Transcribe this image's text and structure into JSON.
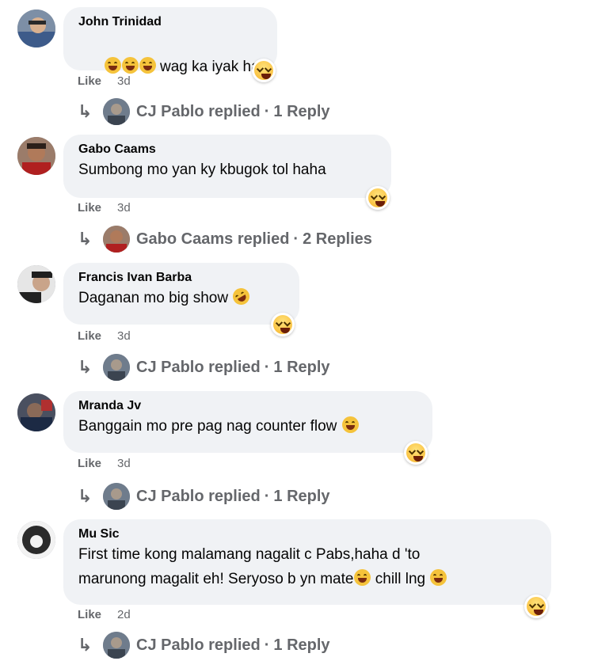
{
  "comments": [
    {
      "author": "John Trinidad",
      "text": "wag ka iyak ha",
      "leading_emojis": [
        "laughing-face",
        "laughing-face",
        "laughing-face"
      ],
      "like_label": "Like",
      "time": "3d",
      "reaction": "haha",
      "replies": {
        "name": "CJ Pablo",
        "replied": "replied",
        "sep": "·",
        "count": "1 Reply"
      }
    },
    {
      "author": "Gabo Caams",
      "text": "Sumbong mo yan ky kbugok tol haha",
      "like_label": "Like",
      "time": "3d",
      "reaction": "haha",
      "replies": {
        "name": "Gabo Caams",
        "replied": "replied",
        "sep": "·",
        "count": "2 Replies"
      }
    },
    {
      "author": "Francis Ivan Barba",
      "text": "Daganan mo big show",
      "trailing_emoji": "rolling-laughing-face",
      "like_label": "Like",
      "time": "3d",
      "reaction": "haha",
      "replies": {
        "name": "CJ Pablo",
        "replied": "replied",
        "sep": "·",
        "count": "1 Reply"
      }
    },
    {
      "author": "Mranda Jv",
      "text": "Banggain mo pre pag nag counter flow",
      "trailing_emoji": "grinning-sweat-face",
      "like_label": "Like",
      "time": "3d",
      "reaction": "haha",
      "replies": {
        "name": "CJ Pablo",
        "replied": "replied",
        "sep": "·",
        "count": "1 Reply"
      }
    },
    {
      "author": "Mu Sic",
      "text_line1": "First time kong malamang nagalit c Pabs,haha d 'to",
      "text_line2a": "marunong magalit eh! Seryoso b yn mate",
      "text_line2b": " chill lng ",
      "like_label": "Like",
      "time": "2d",
      "reaction": "haha",
      "replies": {
        "name": "CJ Pablo",
        "replied": "replied",
        "sep": "·",
        "count": "1 Reply"
      }
    }
  ],
  "colors": {
    "bubble": "#f0f2f5",
    "meta": "#65676b",
    "text": "#050505"
  }
}
